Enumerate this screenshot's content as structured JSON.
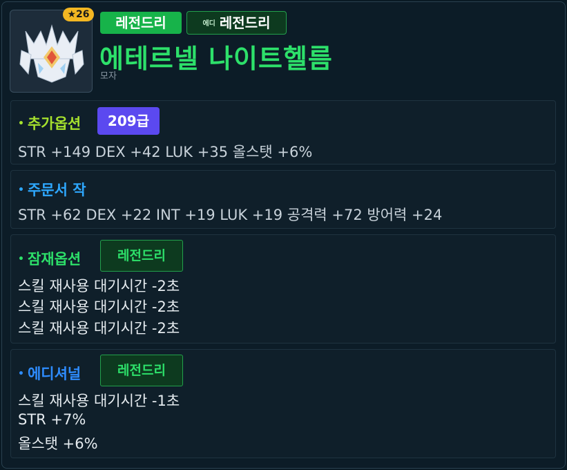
{
  "header": {
    "star_badge": "★26",
    "tag_primary": "레전드리",
    "tag_secondary_prefix": "에디",
    "tag_secondary": "레전드리",
    "item_name": "에테르넬 나이트헬름",
    "item_type": "모자",
    "icon_name": "helmet-icon"
  },
  "sections": {
    "bonus": {
      "title": "추가옵션",
      "grade": "209급",
      "lines": [
        "STR +149 DEX +42 LUK +35 올스탯 +6%"
      ],
      "color": "#a6e22e"
    },
    "scroll": {
      "title": "주문서 작",
      "lines": [
        "STR +62 DEX +22 INT +19 LUK +19 공격력 +72 방어력 +24"
      ],
      "color": "#2ea8ff"
    },
    "potential": {
      "title": "잠재옵션",
      "tag": "레전드리",
      "lines": [
        "스킬 재사용 대기시간 -2초",
        "스킬 재사용 대기시간 -2초",
        "스킬 재사용 대기시간 -2초"
      ],
      "color": "#2de06a"
    },
    "additional": {
      "title": "에디셔널",
      "tag": "레전드리",
      "lines": [
        "스킬 재사용 대기시간 -1초",
        "STR +7%",
        "올스탯 +6%"
      ],
      "color": "#2e8cff"
    }
  },
  "colors": {
    "legend_green": "#2de06a",
    "grade_purple": "#5b49f0",
    "star_gold": "#f3b722"
  }
}
